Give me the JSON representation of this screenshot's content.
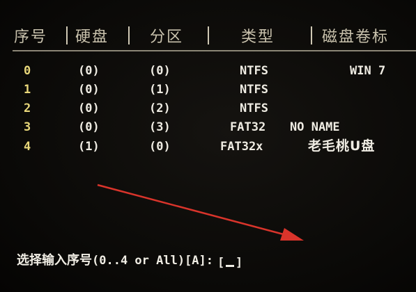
{
  "table": {
    "headers": {
      "index": "序号",
      "disk": "硬盘",
      "partition": "分区",
      "type": "类型",
      "label": "磁盘卷标"
    },
    "separator": "|",
    "rows": [
      {
        "index": "0",
        "disk": "(0)",
        "partition": "(0)",
        "type": "NTFS",
        "label": "WIN 7"
      },
      {
        "index": "1",
        "disk": "(0)",
        "partition": "(1)",
        "type": "NTFS",
        "label": ""
      },
      {
        "index": "2",
        "disk": "(0)",
        "partition": "(2)",
        "type": "NTFS",
        "label": ""
      },
      {
        "index": "3",
        "disk": "(0)",
        "partition": "(3)",
        "type": "FAT32",
        "label": "NO NAME"
      },
      {
        "index": "4",
        "disk": "(1)",
        "partition": "(0)",
        "type": "FAT32x",
        "label": "老毛桃U盘"
      }
    ]
  },
  "prompt": {
    "text_cn": "选择输入序号",
    "text_en": "(0..4 or All)[A]:",
    "input_open": "[",
    "input_close": "]"
  },
  "colors": {
    "background": "#0b0a08",
    "text": "#efece3",
    "index_digits": "#e8d77a",
    "arrow": "#d9342b"
  }
}
